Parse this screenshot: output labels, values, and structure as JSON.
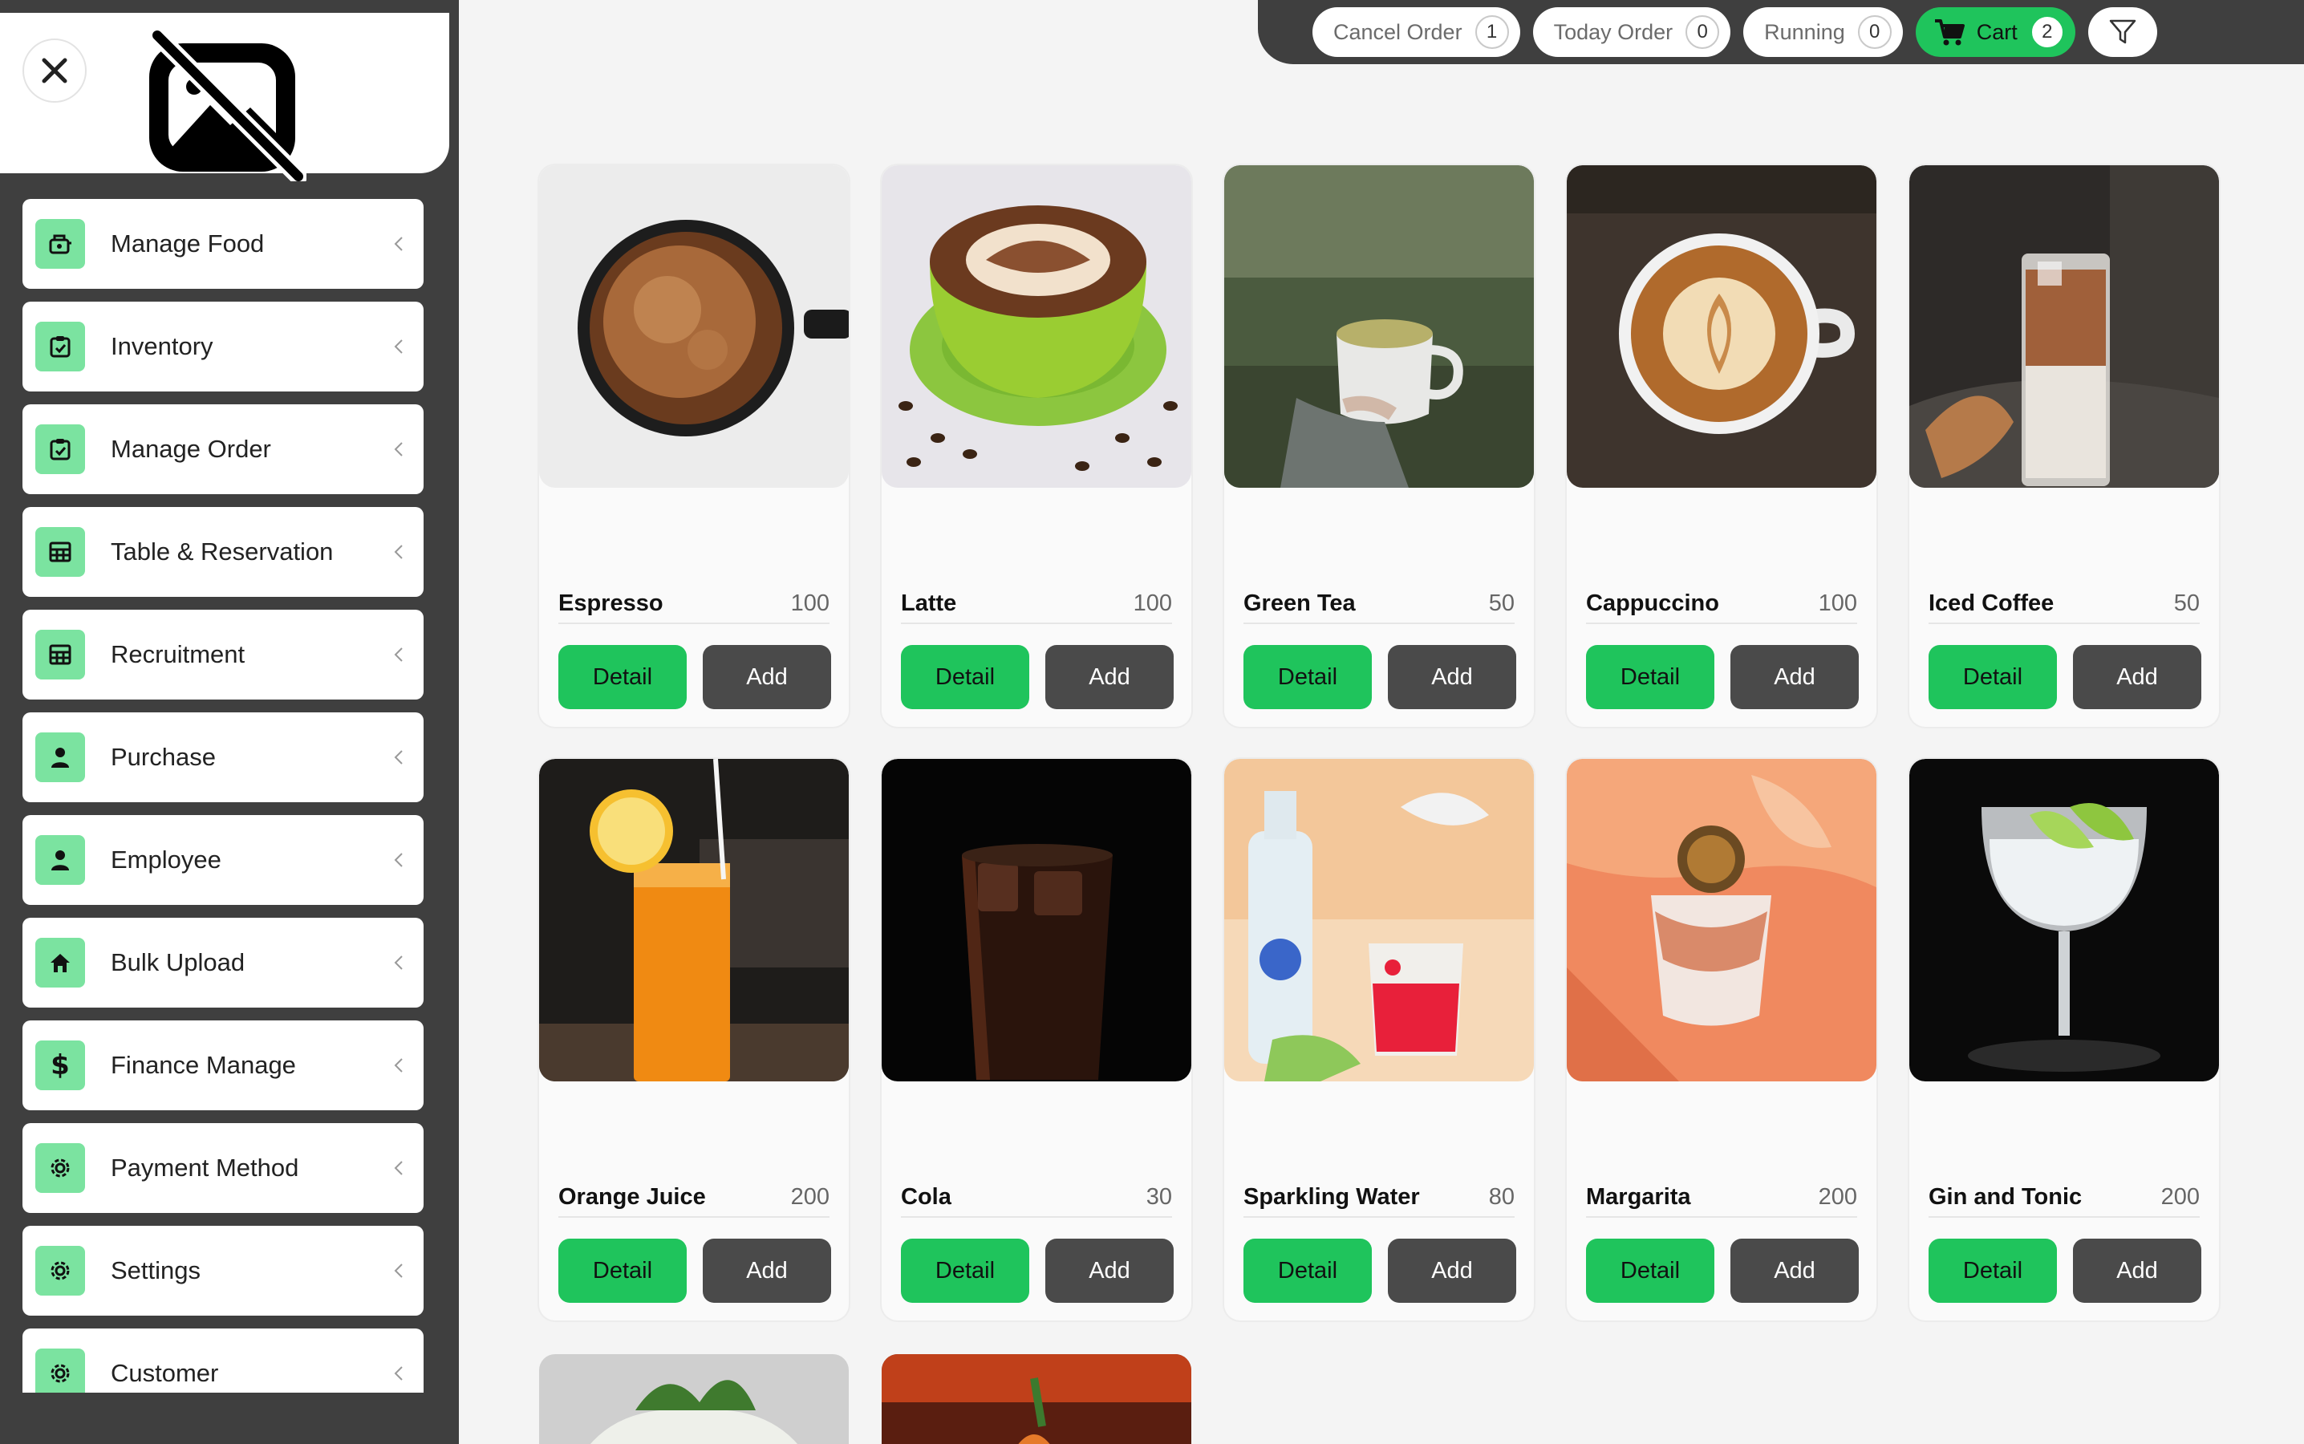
{
  "sidebar": {
    "items": [
      {
        "label": "Manage Food",
        "icon": "food-icon"
      },
      {
        "label": "Inventory",
        "icon": "clipboard-icon"
      },
      {
        "label": "Manage Order",
        "icon": "clipboard-icon"
      },
      {
        "label": "Table & Reservation",
        "icon": "table-icon"
      },
      {
        "label": "Recruitment",
        "icon": "table-icon"
      },
      {
        "label": "Purchase",
        "icon": "user-icon"
      },
      {
        "label": "Employee",
        "icon": "user-icon"
      },
      {
        "label": "Bulk Upload",
        "icon": "home-icon"
      },
      {
        "label": "Finance Manage",
        "icon": "dollar-icon"
      },
      {
        "label": "Payment Method",
        "icon": "gear-icon"
      },
      {
        "label": "Settings",
        "icon": "gear-icon"
      },
      {
        "label": "Customer",
        "icon": "gear-icon"
      }
    ]
  },
  "topbar": {
    "cancel_order": {
      "label": "Cancel Order",
      "count": "1"
    },
    "today_order": {
      "label": "Today Order",
      "count": "0"
    },
    "running": {
      "label": "Running",
      "count": "0"
    },
    "cart": {
      "label": "Cart",
      "count": "2"
    }
  },
  "buttons": {
    "detail": "Detail",
    "add": "Add"
  },
  "products": [
    {
      "name": "Espresso",
      "price": "100"
    },
    {
      "name": "Latte",
      "price": "100"
    },
    {
      "name": "Green Tea",
      "price": "50"
    },
    {
      "name": "Cappuccino",
      "price": "100"
    },
    {
      "name": "Iced Coffee",
      "price": "50"
    },
    {
      "name": "Orange Juice",
      "price": "200"
    },
    {
      "name": "Cola",
      "price": "30"
    },
    {
      "name": "Sparkling Water",
      "price": "80"
    },
    {
      "name": "Margarita",
      "price": "200"
    },
    {
      "name": "Gin and Tonic",
      "price": "200"
    }
  ],
  "colors": {
    "accent": "#1fc45c",
    "sidebar_bg": "#3f3f3f",
    "icon_bg": "#7be3a0",
    "add_button": "#4a4a4a"
  }
}
